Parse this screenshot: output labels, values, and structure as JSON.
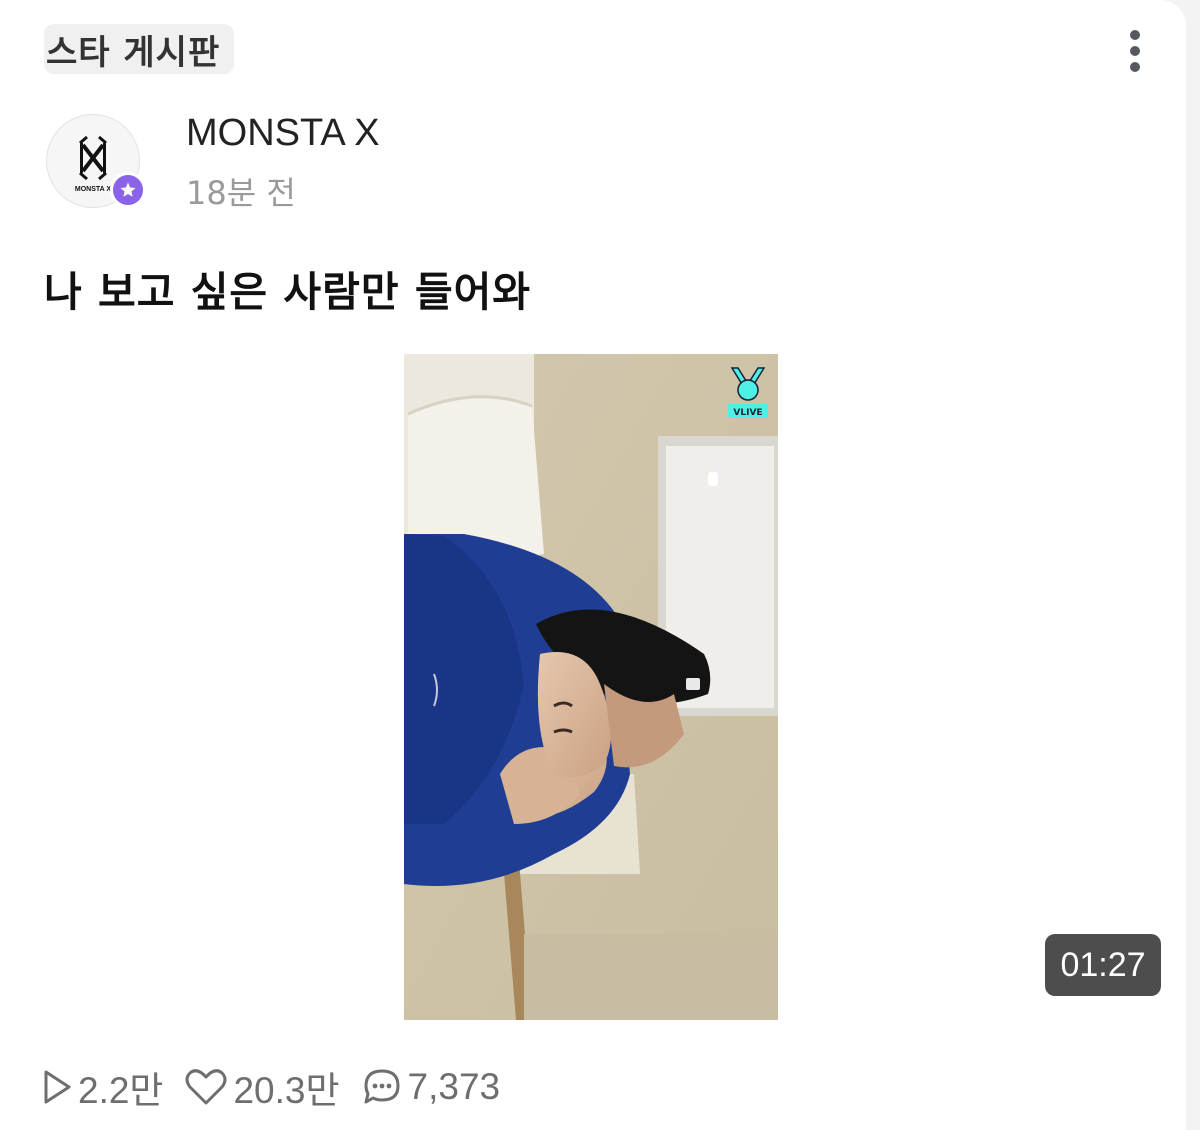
{
  "board": {
    "label": "스타 게시판"
  },
  "menu": {
    "icon": "more-vertical-icon"
  },
  "author": {
    "name": "MONSTA X",
    "time": "18분 전",
    "avatar_logo_text": "MONSTA X",
    "badge_icon": "star-icon",
    "badge_color": "#8a63e8"
  },
  "post": {
    "title": "나 보고 싶은 사람만 들어와",
    "video": {
      "duration": "01:27",
      "badge_label": "VLIVE",
      "badge_icon": "v-hand-icon",
      "badge_color": "#4ef0e6"
    }
  },
  "stats": {
    "plays": "2.2만",
    "likes": "20.3만",
    "comments": "7,373",
    "play_icon": "play-icon",
    "like_icon": "heart-icon",
    "comment_icon": "comment-icon"
  }
}
